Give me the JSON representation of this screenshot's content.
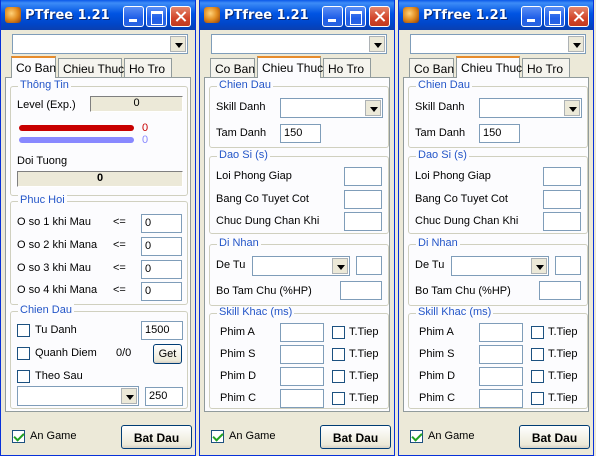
{
  "app": {
    "title": "PTfree 1.21",
    "accent_title": "#0054e3",
    "group_label_color": "#2456c8",
    "hp_color": "#c80000",
    "mp_color": "#8888ff"
  },
  "tabs": [
    "Co Ban",
    "Chieu Thuc",
    "Ho Tro"
  ],
  "win1": {
    "thong_tin": {
      "title": "Thông Tin",
      "level_label": "Level (Exp.)",
      "level_value": "0",
      "hp_value": "0",
      "mp_value": "0",
      "doi_tuong_label": "Doi Tuong",
      "doi_tuong_value": "0"
    },
    "phuc_hoi": {
      "title": "Phuc Hoi",
      "rows": [
        {
          "label": "O so 1 khi  Mau",
          "op": "<=",
          "value": "0"
        },
        {
          "label": "O so 2 khi  Mana",
          "op": "<=",
          "value": "0"
        },
        {
          "label": "O so 3 khi  Mau",
          "op": "<=",
          "value": "0"
        },
        {
          "label": "O so 4 khi  Mana",
          "op": "<=",
          "value": "0"
        }
      ]
    },
    "chien_dau": {
      "title": "Chien Dau",
      "tu_danh_label": "Tu Danh",
      "tu_danh_value": "1500",
      "quanh_diem_label": "Quanh Diem",
      "quanh_diem_count": "0/0",
      "get_label": "Get",
      "theo_sau_label": "Theo Sau",
      "theo_sau_value": "250"
    }
  },
  "win2": {
    "chien_dau": {
      "title": "Chien Dau",
      "skill_label": "Skill Danh",
      "tam_label": "Tam Danh",
      "tam_value": "150"
    },
    "dao_si": {
      "title": "Dao Si (s)",
      "rows": [
        "Loi Phong Giap",
        "Bang Co Tuyet Cot",
        "Chuc Dung Chan Khi"
      ]
    },
    "di_nhan": {
      "title": "Di Nhan",
      "de_tu_label": "De Tu",
      "bo_tam_label": "Bo Tam Chu (%HP)"
    },
    "skill_khac": {
      "title": "Skill Khac (ms)",
      "rows": [
        {
          "label": "Phim A",
          "tiep": "T.Tiep"
        },
        {
          "label": "Phim S",
          "tiep": "T.Tiep"
        },
        {
          "label": "Phim D",
          "tiep": "T.Tiep"
        },
        {
          "label": "Phim C",
          "tiep": "T.Tiep"
        }
      ]
    }
  },
  "footer": {
    "an_game_label": "An Game",
    "an_game_checked": true,
    "start_label": "Bat Dau"
  }
}
